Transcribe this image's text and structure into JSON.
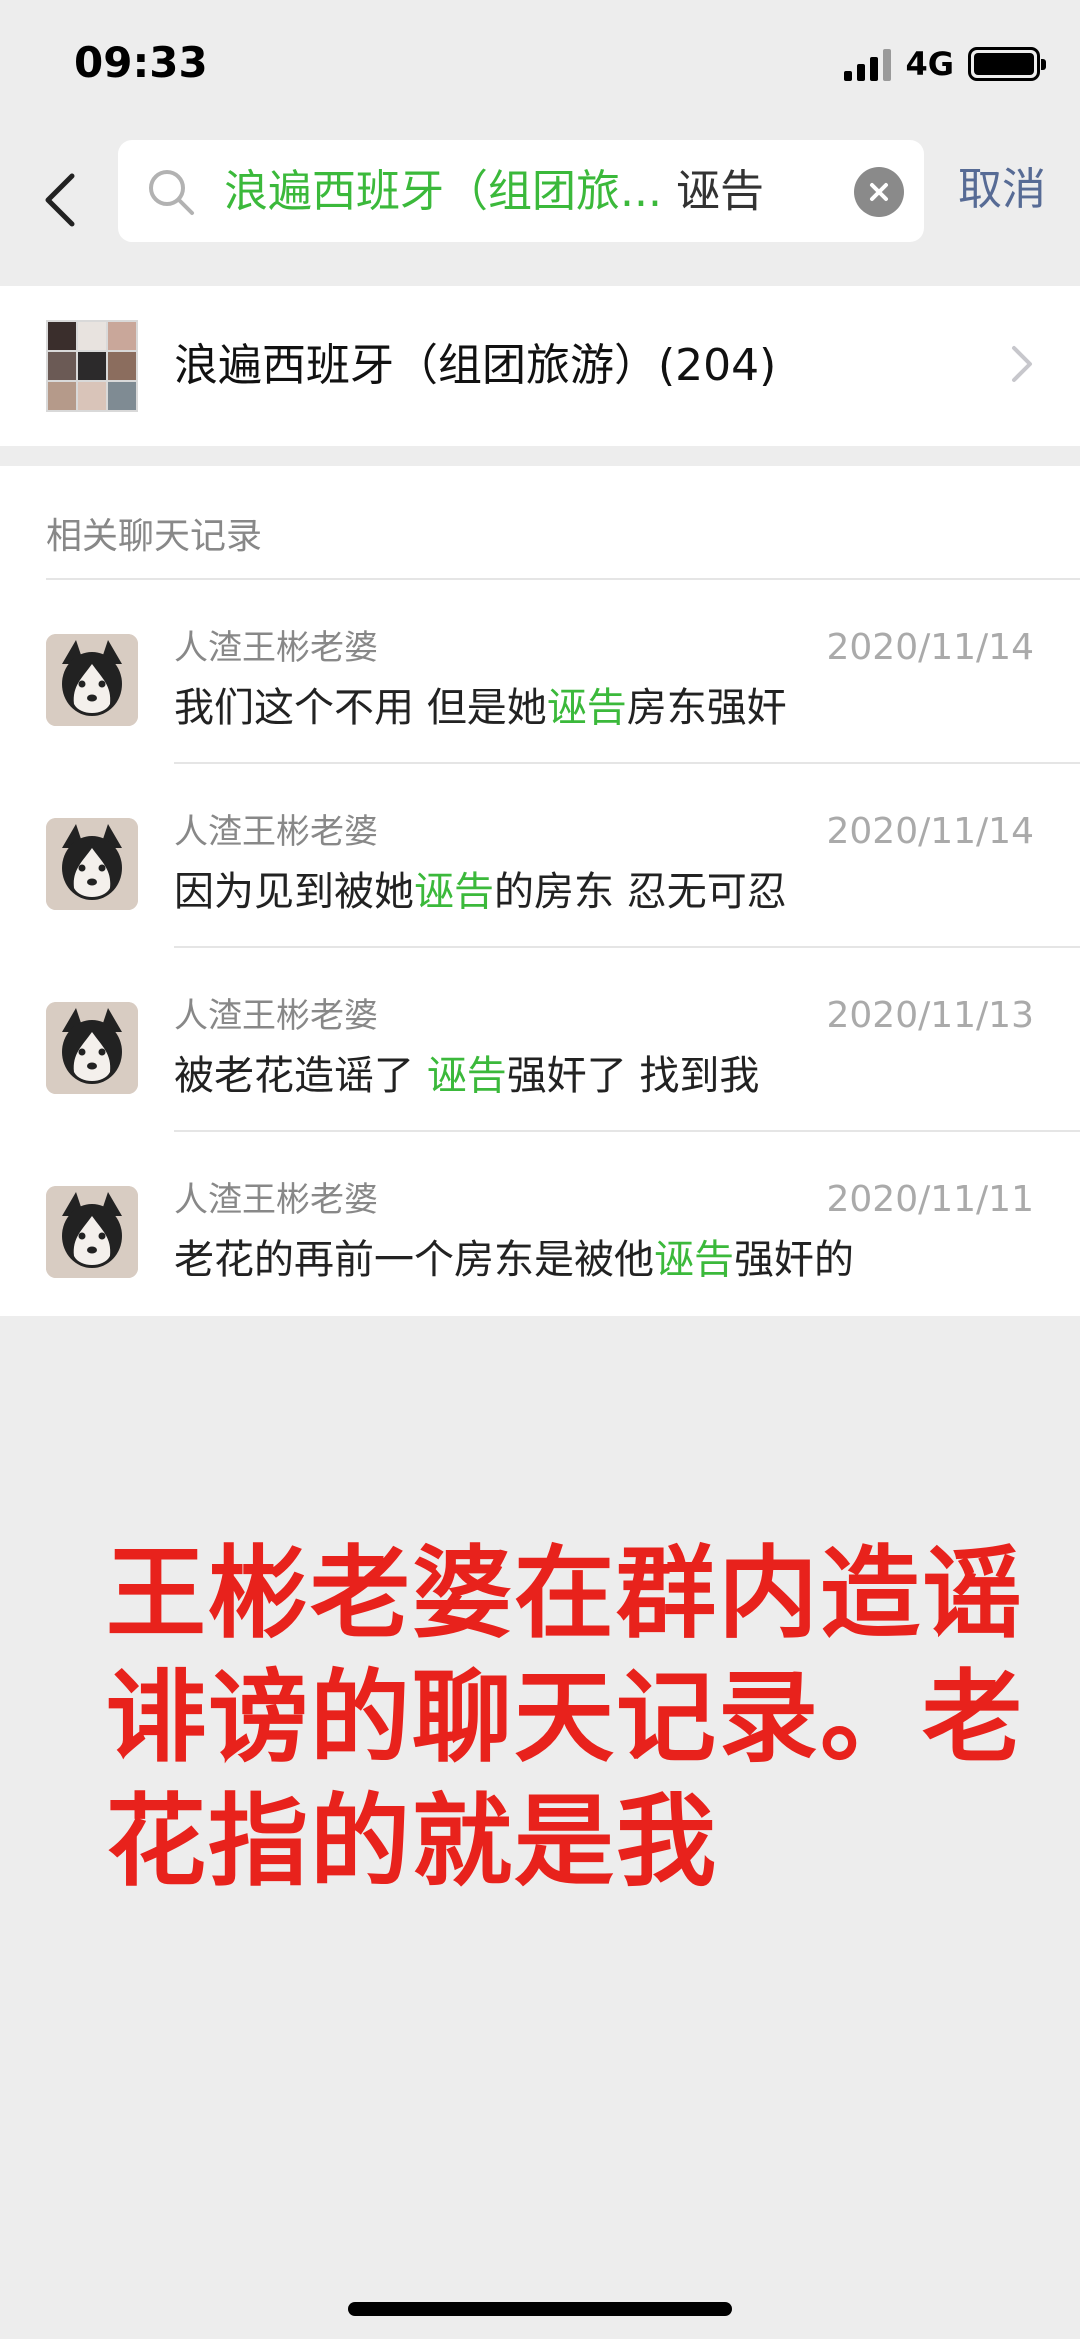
{
  "status_bar": {
    "time": "09:33",
    "network": "4G"
  },
  "search": {
    "scope": "浪遍西班牙（组团旅...",
    "query": "诬告",
    "cancel_label": "取消",
    "icons": [
      "back-chevron-icon",
      "search-icon",
      "clear-icon"
    ]
  },
  "group": {
    "name": "浪遍西班牙（组团旅游）(204)"
  },
  "records": {
    "section_title": "相关聊天记录",
    "highlight_color": "#1aad19",
    "items": [
      {
        "sender": "人渣王彬老婆",
        "date": "2020/11/14",
        "before": "我们这个不用 但是她",
        "keyword": "诬告",
        "after": "房东强奸"
      },
      {
        "sender": "人渣王彬老婆",
        "date": "2020/11/14",
        "before": "因为见到被她",
        "keyword": "诬告",
        "after": "的房东 忍无可忍"
      },
      {
        "sender": "人渣王彬老婆",
        "date": "2020/11/13",
        "before": "被老花造谣了 ",
        "keyword": "诬告",
        "after": "强奸了 找到我"
      },
      {
        "sender": "人渣王彬老婆",
        "date": "2020/11/11",
        "before": "老花的再前一个房东是被他",
        "keyword": "诬告",
        "after": "强奸的"
      }
    ]
  },
  "annotation": {
    "text": "王彬老婆在群内造谣诽谤的聊天记录。老花指的就是我",
    "color": "#e8221c"
  }
}
